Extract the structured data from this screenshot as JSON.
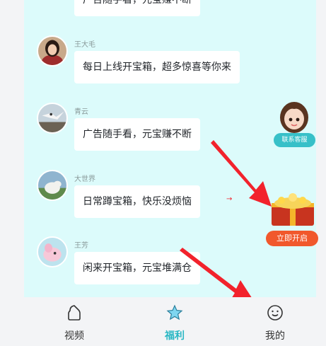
{
  "messages": [
    {
      "sender": "",
      "text": "广告随手看，元宝赚不断",
      "avatar_icon": "avatar-icon"
    },
    {
      "sender": "王大毛",
      "text": "每日上线开宝箱，超多惊喜等你来",
      "avatar_icon": "woman-portrait-avatar-icon"
    },
    {
      "sender": "青云",
      "text": "广告随手看，元宝赚不断",
      "avatar_icon": "bird-landscape-avatar-icon"
    },
    {
      "sender": "大世界",
      "text": "日常蹲宝箱，快乐没烦恼",
      "avatar_icon": "sheep-avatar-icon"
    },
    {
      "sender": "王芳",
      "text": "闲来开宝箱，元宝堆满仓",
      "avatar_icon": "pink-creature-avatar-icon"
    }
  ],
  "floating": {
    "service_label": "联系客服",
    "chest_button": "立即开启",
    "arrow_mark": "→"
  },
  "tabbar": {
    "tabs": [
      {
        "label": "视频",
        "icon": "video-icon",
        "active": false
      },
      {
        "label": "福利",
        "icon": "star-icon",
        "active": true
      },
      {
        "label": "我的",
        "icon": "smile-face-icon",
        "active": false
      }
    ]
  },
  "colors": {
    "chat_bg": "#dcfbfb",
    "accent": "#2ab7c4",
    "chest_button": "#f1582c",
    "arrow": "#f2222c"
  }
}
